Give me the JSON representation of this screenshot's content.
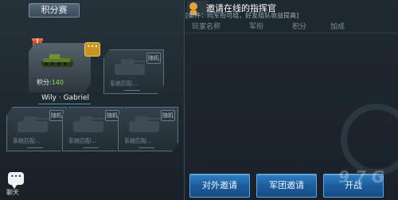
{
  "left": {
    "tab_title": "积分赛",
    "player": {
      "score_label": "积分:",
      "score_value": "140",
      "name": "Wily · Gabriel"
    },
    "slots": [
      {
        "badge": "随机",
        "status": "系统匹配..."
      },
      {
        "badge": "随机",
        "status": "系统匹配..."
      },
      {
        "badge": "随机",
        "status": "系统匹配..."
      },
      {
        "badge": "随机",
        "status": "系统匹配..."
      }
    ],
    "chat_label": "聊天"
  },
  "right": {
    "title": "邀请在线的指挥官",
    "subtitle": "[条件：同军衔可组，好友组队收益提高]",
    "columns": [
      "玩家名称",
      "军衔",
      "积分",
      "加成"
    ]
  },
  "buttons": {
    "external_invite": "对外邀请",
    "team_invite": "军团邀请",
    "start": "开战"
  },
  "watermark": "9 7 G",
  "colors": {
    "accent_blue": "#1b5a99",
    "score_green": "#86e05a",
    "gold": "#c8931f"
  }
}
